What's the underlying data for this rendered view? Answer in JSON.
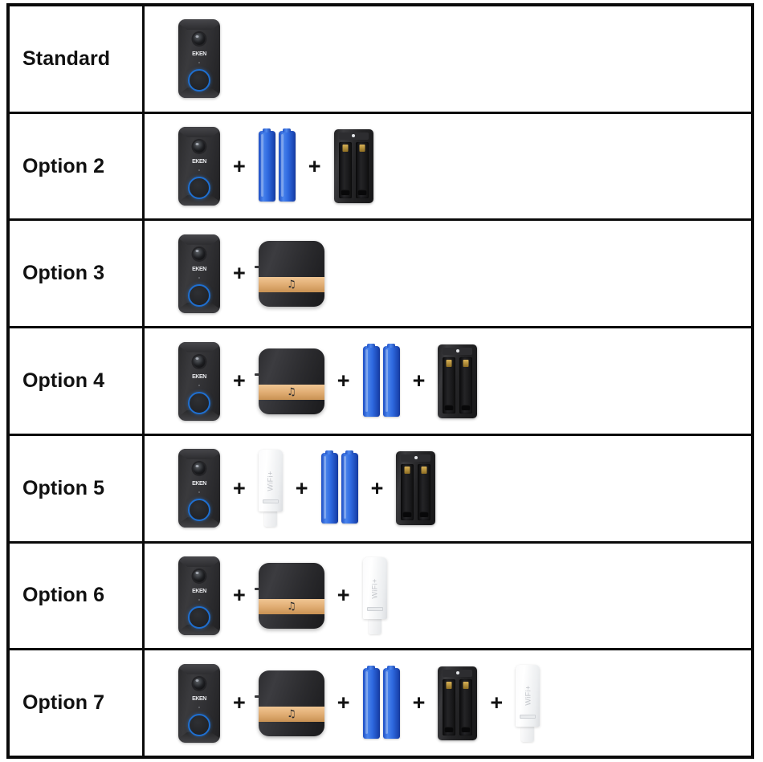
{
  "table": {
    "rows": [
      {
        "label": "Standard",
        "items": [
          "doorbell"
        ]
      },
      {
        "label": "Option 2",
        "items": [
          "doorbell",
          "batteries",
          "charger"
        ]
      },
      {
        "label": "Option 3",
        "items": [
          "doorbell",
          "chime"
        ]
      },
      {
        "label": "Option 4",
        "items": [
          "doorbell",
          "chime",
          "batteries",
          "charger"
        ]
      },
      {
        "label": "Option 5",
        "items": [
          "doorbell",
          "wifi-extender",
          "batteries",
          "charger"
        ]
      },
      {
        "label": "Option 6",
        "items": [
          "doorbell",
          "chime",
          "wifi-extender"
        ]
      },
      {
        "label": "Option 7",
        "items": [
          "doorbell",
          "chime",
          "batteries",
          "charger",
          "wifi-extender"
        ]
      }
    ],
    "separator": "+"
  },
  "products": {
    "doorbell": {
      "name": "video-doorbell",
      "brand": "EKEN",
      "body_color": "#2e2e31",
      "button_ring_color": "#1f6fd0"
    },
    "batteries": {
      "name": "rechargeable-battery-pair",
      "count": 2,
      "color": "#2f6ae0"
    },
    "charger": {
      "name": "dual-slot-battery-charger",
      "slots": 2,
      "color": "#1d1d1f",
      "contact_color": "#d9b257"
    },
    "chime": {
      "name": "wireless-chime-receiver",
      "icon": "music-note-icon",
      "note_glyph": "♫",
      "body_color": "#2b2b2e",
      "band_color": "#e3b077"
    },
    "wifi_extender": {
      "name": "wifi-range-extender",
      "label": "WiFi+",
      "color": "#f5f6f7"
    }
  },
  "colors": {
    "border": "#0a0a0a",
    "background": "#ffffff",
    "text": "#111111"
  }
}
